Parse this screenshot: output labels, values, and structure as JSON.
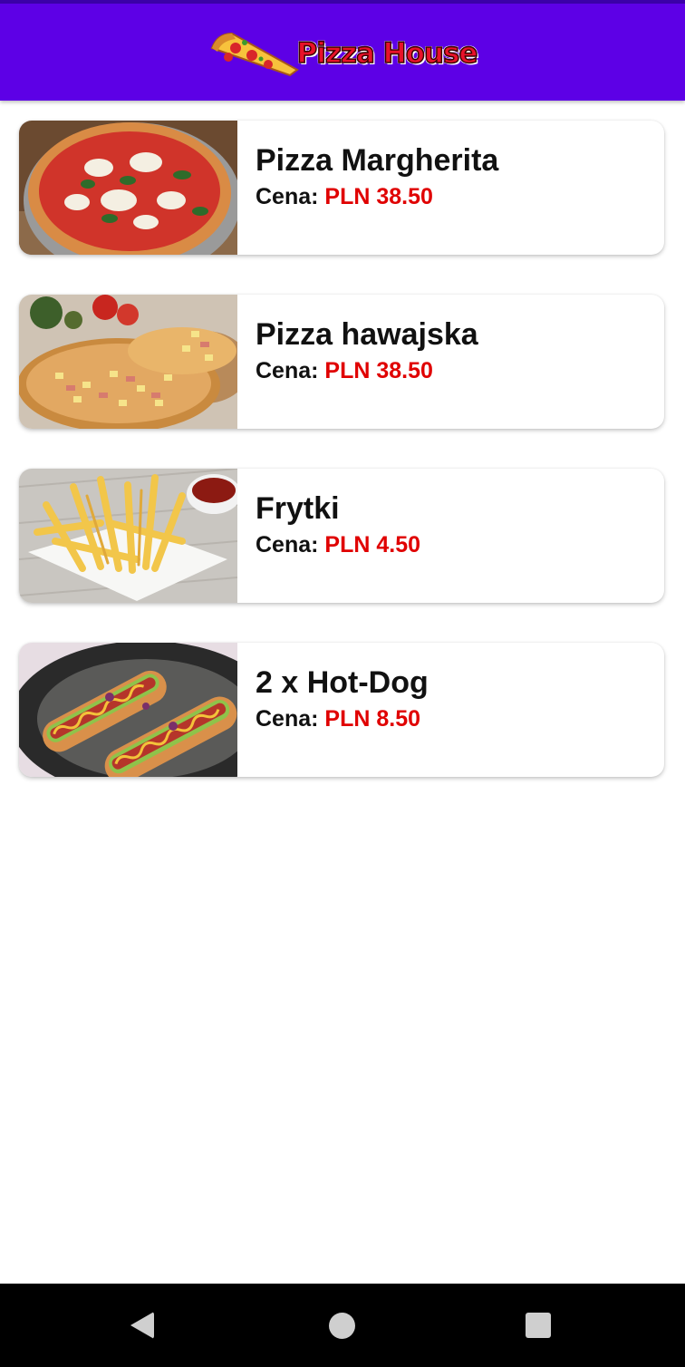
{
  "app": {
    "title": "Pizza House",
    "colors": {
      "header": "#5d00e6",
      "price": "#e00000",
      "text": "#111111"
    }
  },
  "menu": {
    "price_label": "Cena:",
    "items": [
      {
        "name": "Pizza Margherita",
        "price": "PLN 38.50",
        "image_icon": "pizza-margherita-photo"
      },
      {
        "name": "Pizza hawajska",
        "price": "PLN 38.50",
        "image_icon": "pizza-hawajska-photo"
      },
      {
        "name": "Frytki",
        "price": "PLN 4.50",
        "image_icon": "fries-photo"
      },
      {
        "name": "2 x Hot-Dog",
        "price": "PLN 8.50",
        "image_icon": "hotdog-photo"
      }
    ]
  },
  "navbar": {
    "back_icon": "back-triangle-icon",
    "home_icon": "home-circle-icon",
    "recent_icon": "recents-square-icon"
  }
}
